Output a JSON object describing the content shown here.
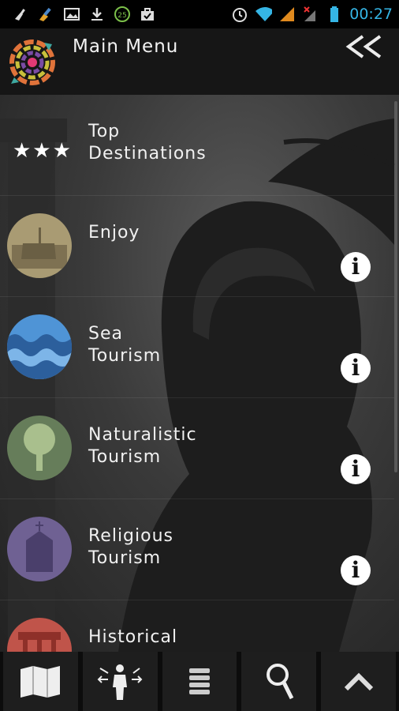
{
  "status_bar": {
    "time": "00:27",
    "notification_icons": [
      "broom-icon",
      "brush-icon",
      "image-icon",
      "download-icon",
      "badge-25-icon",
      "briefcase-icon"
    ],
    "system_icons": [
      "alarm-icon",
      "wifi-icon",
      "signal-icon",
      "signal-muted-icon",
      "battery-icon"
    ],
    "badge_text": "25"
  },
  "header": {
    "title": "Main Menu",
    "back_icon": "double-chevron-left-icon"
  },
  "menu": {
    "items": [
      {
        "label": "Top\nDestinations",
        "icon": "three-stars-icon",
        "has_info": false
      },
      {
        "label": "Enjoy",
        "icon": "enjoy-icon",
        "has_info": true,
        "circle_color": "#a99b73"
      },
      {
        "label": "Sea\nTourism",
        "icon": "sea-waves-icon",
        "has_info": true,
        "circle_color": "#4f94d6"
      },
      {
        "label": "Naturalistic\nTourism",
        "icon": "tree-icon",
        "has_info": true,
        "circle_color": "#667d5a"
      },
      {
        "label": "Religious\nTourism",
        "icon": "church-icon",
        "has_info": true,
        "circle_color": "#6f6193"
      },
      {
        "label": "Historical",
        "icon": "temple-icon",
        "has_info": false,
        "circle_color": "#c0544a"
      }
    ],
    "info_glyph": "i"
  },
  "bottom_bar": {
    "tabs": [
      {
        "icon": "map-icon"
      },
      {
        "icon": "person-arrows-icon"
      },
      {
        "icon": "list-icon"
      },
      {
        "icon": "search-magnifier-icon"
      },
      {
        "icon": "chevron-up-icon"
      }
    ]
  },
  "colors": {
    "clock": "#35b5e5",
    "header_bg": "#161616",
    "status_bg": "#000000"
  }
}
